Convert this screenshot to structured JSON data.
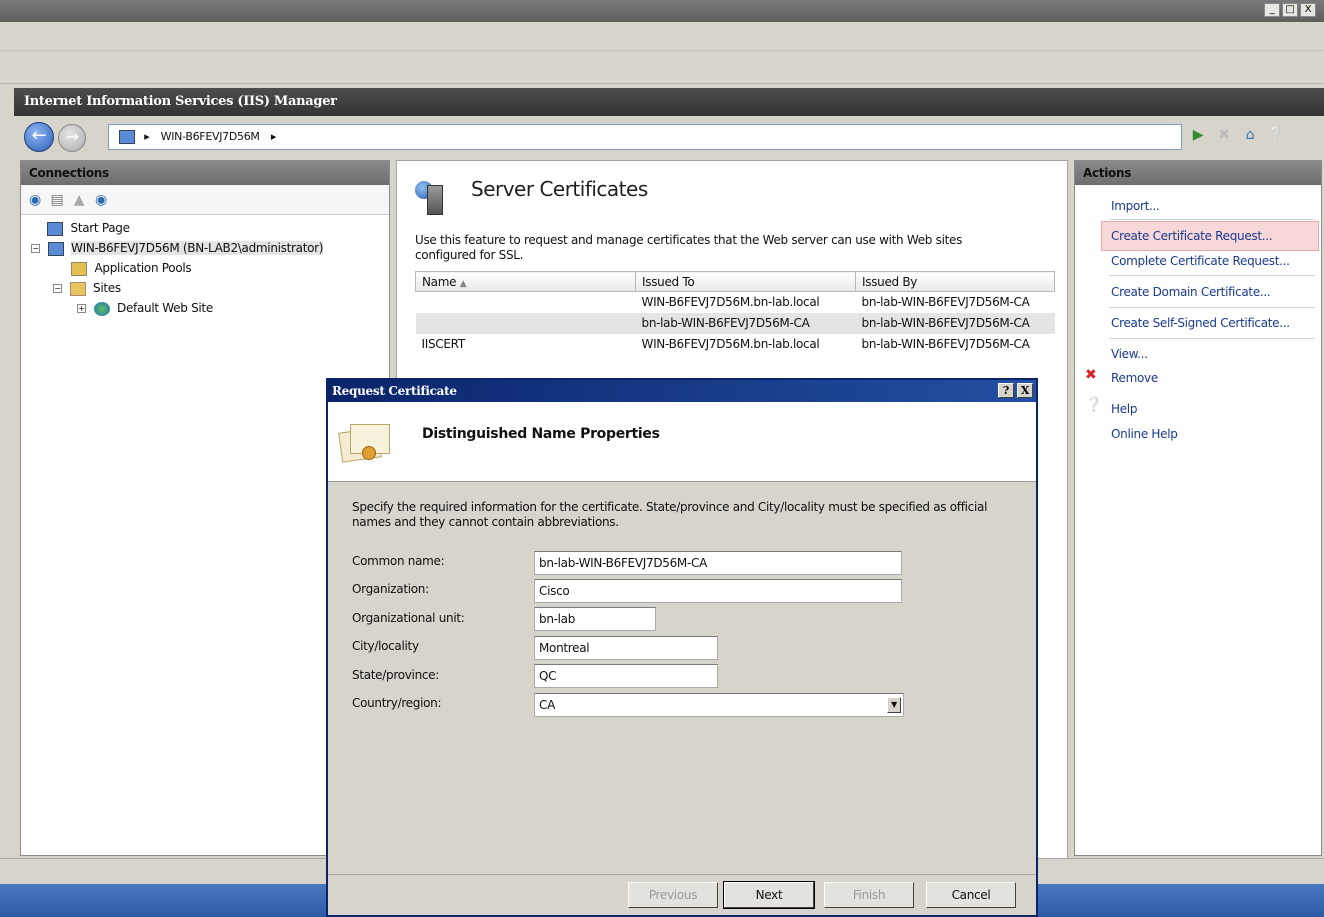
{
  "window_controls": [
    "_",
    "□",
    "X"
  ],
  "app": {
    "title": "Internet Information Services (IIS) Manager"
  },
  "nav": {
    "address_path": "WIN-B6FEVJ7D56M",
    "separator": "▸"
  },
  "connections": {
    "title": "Connections",
    "tree": [
      {
        "label": "Start Page"
      },
      {
        "label": "WIN-B6FEVJ7D56M (BN-LAB2\\administrator)"
      },
      {
        "label": "Application Pools"
      },
      {
        "label": "Sites"
      },
      {
        "label": "Default Web Site"
      }
    ]
  },
  "center": {
    "title": "Server Certificates",
    "description": "Use this feature to request and manage certificates that the Web server can use with Web sites configured for SSL.",
    "table": {
      "columns": [
        "Name",
        "Issued To",
        "Issued By"
      ],
      "rows": [
        {
          "name": "",
          "issued_to": "WIN-B6FEVJ7D56M.bn-lab.local",
          "issued_by": "bn-lab-WIN-B6FEVJ7D56M-CA"
        },
        {
          "name": "",
          "issued_to": "bn-lab-WIN-B6FEVJ7D56M-CA",
          "issued_by": "bn-lab-WIN-B6FEVJ7D56M-CA"
        },
        {
          "name": "IISCERT",
          "issued_to": "WIN-B6FEVJ7D56M.bn-lab.local",
          "issued_by": "bn-lab-WIN-B6FEVJ7D56M-CA"
        }
      ]
    }
  },
  "actions": {
    "title": "Actions",
    "items": [
      {
        "label": "Import..."
      },
      {
        "label": "Create Certificate Request..."
      },
      {
        "label": "Complete Certificate Request..."
      },
      {
        "label": "Create Domain Certificate..."
      },
      {
        "label": "Create Self-Signed Certificate..."
      },
      {
        "label": "View..."
      },
      {
        "label": "Remove"
      },
      {
        "label": "Help"
      },
      {
        "label": "Online Help"
      }
    ],
    "highlight_color": "#f6d8d8"
  },
  "dialog": {
    "title": "Request Certificate",
    "help_btn": "?",
    "close_btn": "X",
    "header": "Distinguished Name Properties",
    "intro": "Specify the required information for the certificate. State/province and City/locality must be specified as official names and they cannot contain abbreviations.",
    "fields": [
      {
        "label": "Common name:",
        "value": "bn-lab-WIN-B6FEVJ7D56M-CA"
      },
      {
        "label": "Organization:",
        "value": "Cisco"
      },
      {
        "label": "Organizational unit:",
        "value": "bn-lab"
      },
      {
        "label": "City/locality",
        "value": "Montreal"
      },
      {
        "label": "State/province:",
        "value": "QC"
      },
      {
        "label": "Country/region:",
        "value": "CA"
      }
    ],
    "buttons": {
      "previous": "Previous",
      "next": "Next",
      "finish": "Finish",
      "cancel": "Cancel"
    }
  }
}
